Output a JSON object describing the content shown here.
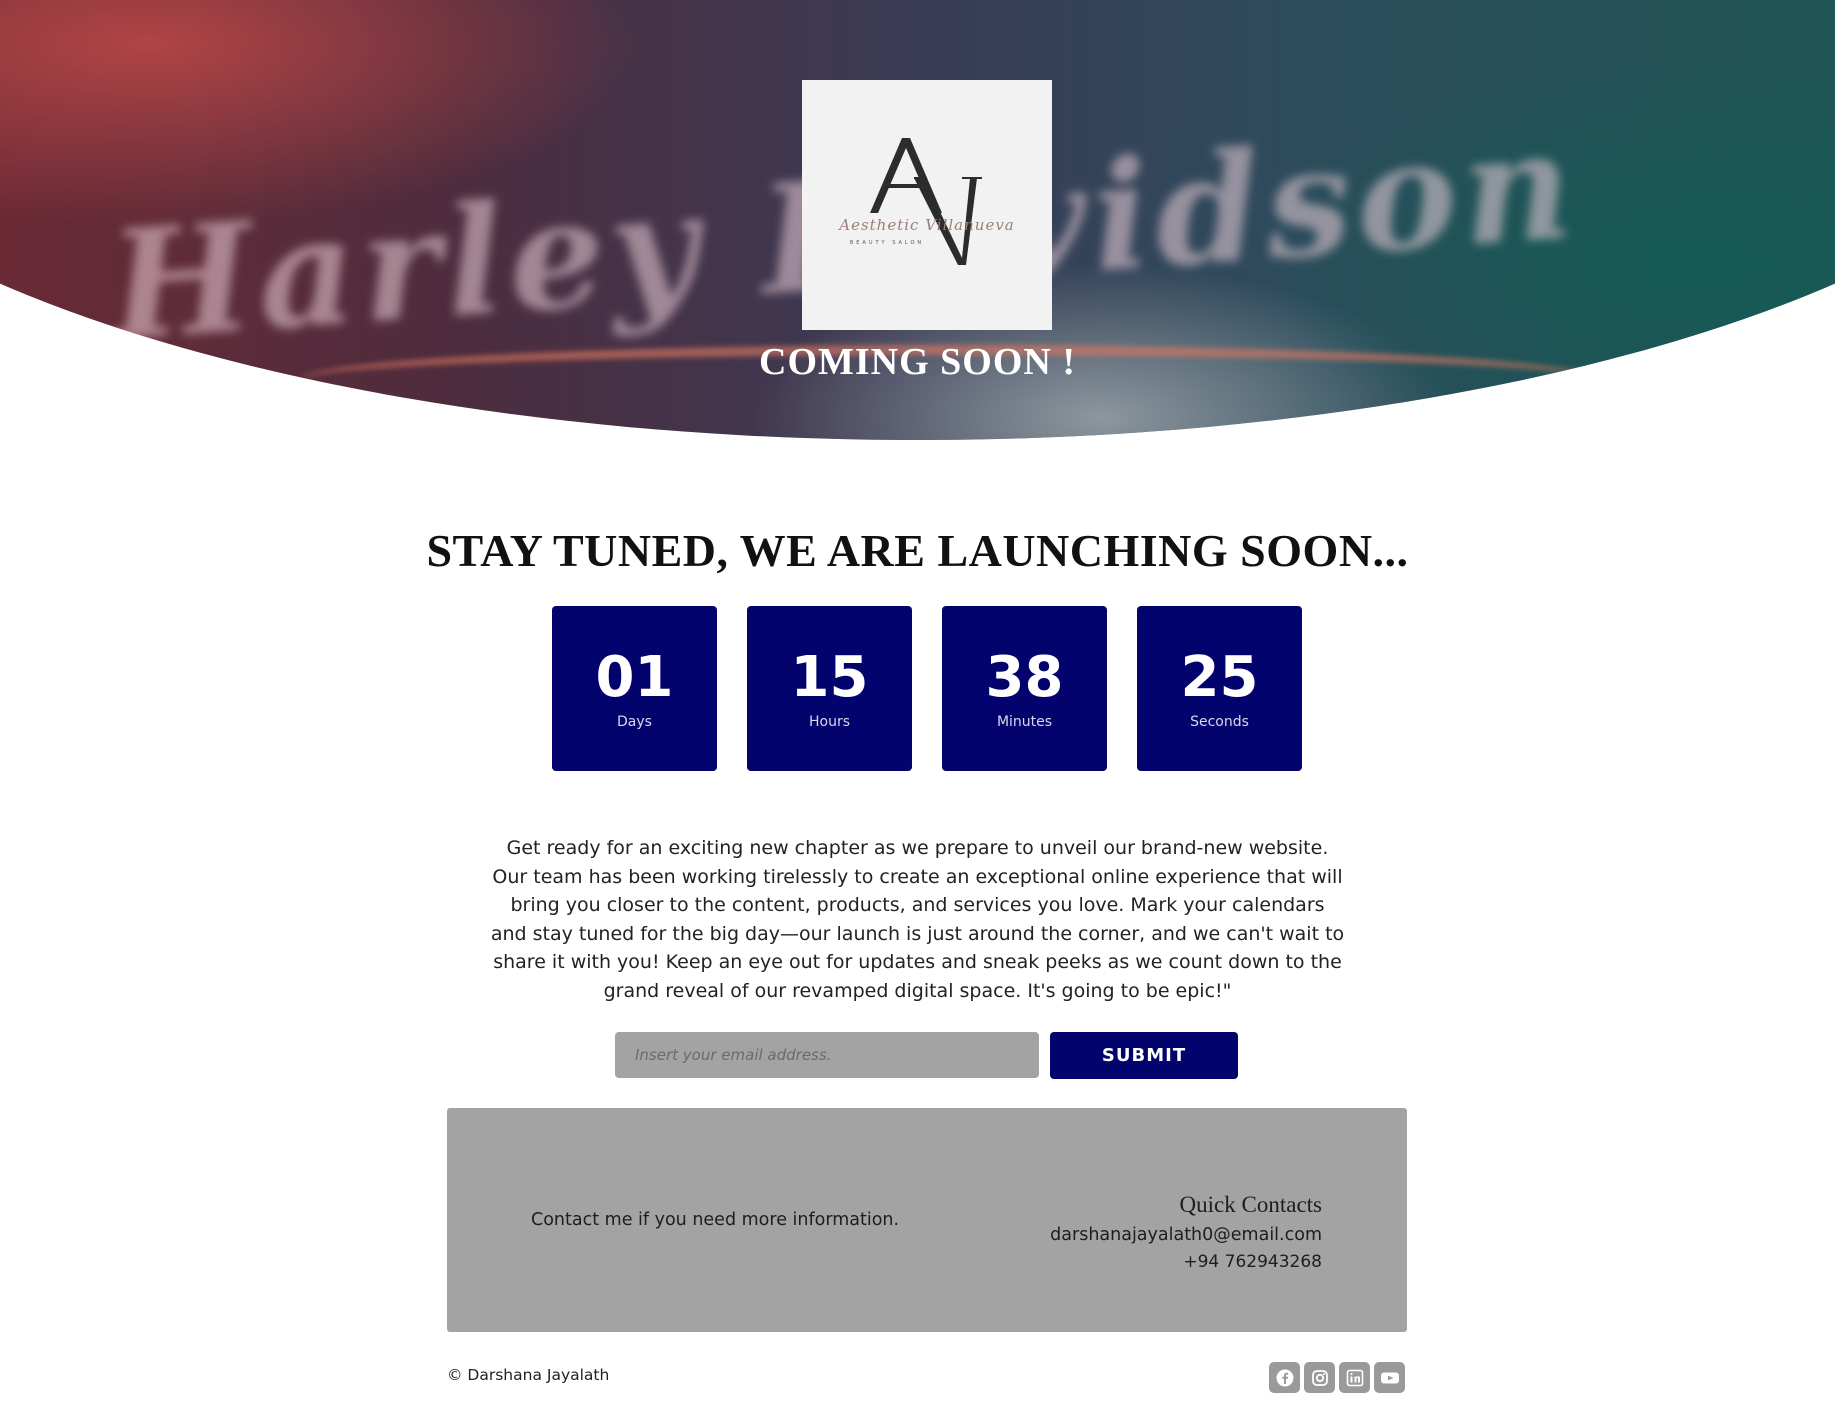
{
  "hero": {
    "background_script_text": "Harley Davidson",
    "logo": {
      "monogram": "AV",
      "script_name": "Aesthetic Villanueva",
      "tagline": "BEAUTY SALON"
    },
    "heading": "COMING SOON !"
  },
  "main": {
    "headline": "STAY TUNED, WE ARE LAUNCHING SOON...",
    "countdown": [
      {
        "value": "01",
        "label": "Days"
      },
      {
        "value": "15",
        "label": "Hours"
      },
      {
        "value": "38",
        "label": "Minutes"
      },
      {
        "value": "25",
        "label": "Seconds"
      }
    ],
    "description": "Get ready for an exciting new chapter as we prepare to unveil our brand-new website. Our team has been working tirelessly to create an exceptional online experience that will bring you closer to the content, products, and services you love. Mark your calendars and stay tuned for the big day—our launch is just around the corner, and we can't wait to share it with you! Keep an eye out for updates and sneak peeks as we count down to the grand reveal of our revamped digital space. It's going to be epic!\"",
    "email_form": {
      "placeholder": "Insert your email address.",
      "value": "",
      "submit_label": "SUBMIT"
    }
  },
  "footer": {
    "contact_text": "Contact me if you need more information.",
    "quick_contacts": {
      "title": "Quick Contacts",
      "email": "darshanajayalath0@email.com",
      "phone": "+94 762943268"
    },
    "copyright": "© Darshana Jayalath",
    "socials": [
      "facebook-icon",
      "instagram-icon",
      "linkedin-icon",
      "youtube-icon"
    ]
  },
  "colors": {
    "accent_navy": "#03036e",
    "panel_gray": "#a3a3a3",
    "social_gray": "#9a9a9a"
  }
}
